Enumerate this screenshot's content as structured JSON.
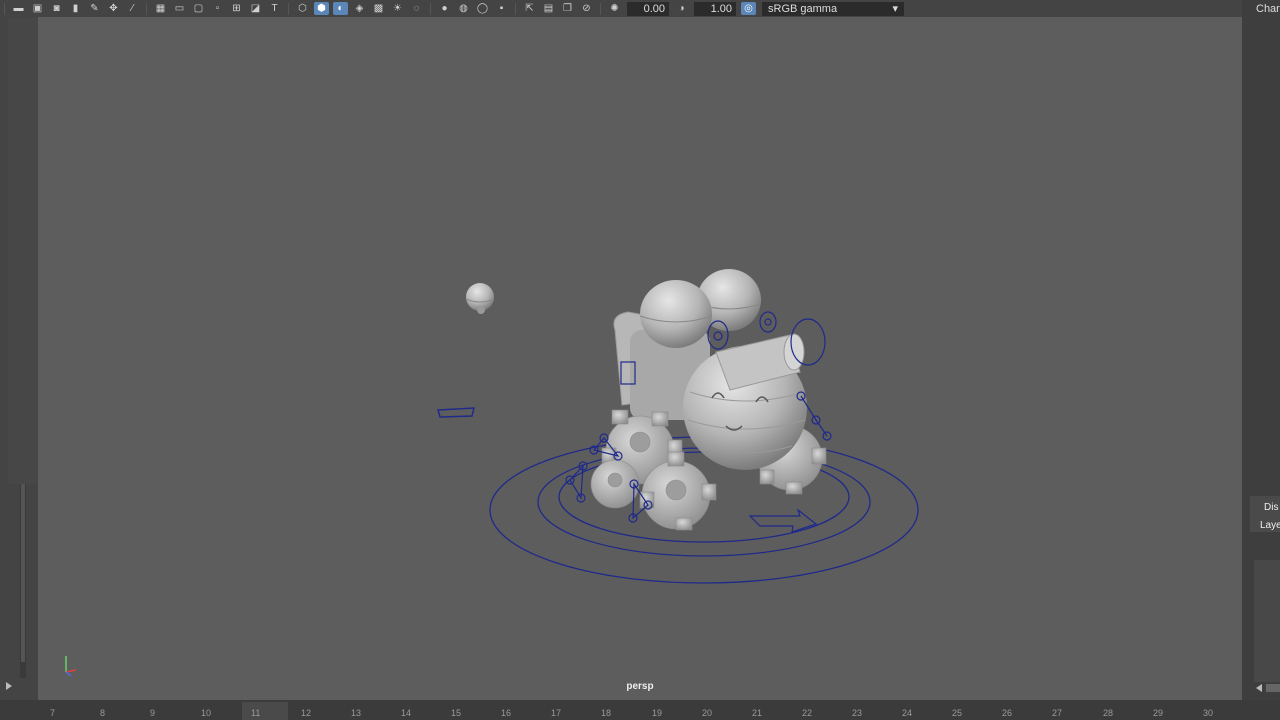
{
  "toolbar": {
    "exposure_value": "0.00",
    "gamma_value": "1.00",
    "color_space": "sRGB gamma",
    "icons": [
      "camera-icon",
      "camera-attrs-icon",
      "bookmark-icon",
      "image-plane-icon",
      "grid-icon",
      "film-gate-icon",
      "resolution-gate-icon",
      "wireframe-icon",
      "smooth-shade-icon",
      "textured-icon",
      "lights-icon",
      "shadows-icon",
      "xray-icon",
      "isolate-icon",
      "exposure-icon",
      "gamma-icon",
      "color-management-icon"
    ]
  },
  "viewport": {
    "camera_label": "persp",
    "background_color": "#5d5d5d",
    "rig_curve_color": "#1f2a8a"
  },
  "right_panel": {
    "channel_tab": "Char",
    "display_tab": "Dis",
    "layers_tab": "Laye"
  },
  "timeline": {
    "frames": [
      "7",
      "8",
      "9",
      "10",
      "11",
      "12",
      "13",
      "14",
      "15",
      "16",
      "17",
      "18",
      "19",
      "20",
      "21",
      "22",
      "23",
      "24",
      "25",
      "26",
      "27",
      "28",
      "29",
      "30"
    ],
    "current_frame": "11"
  }
}
